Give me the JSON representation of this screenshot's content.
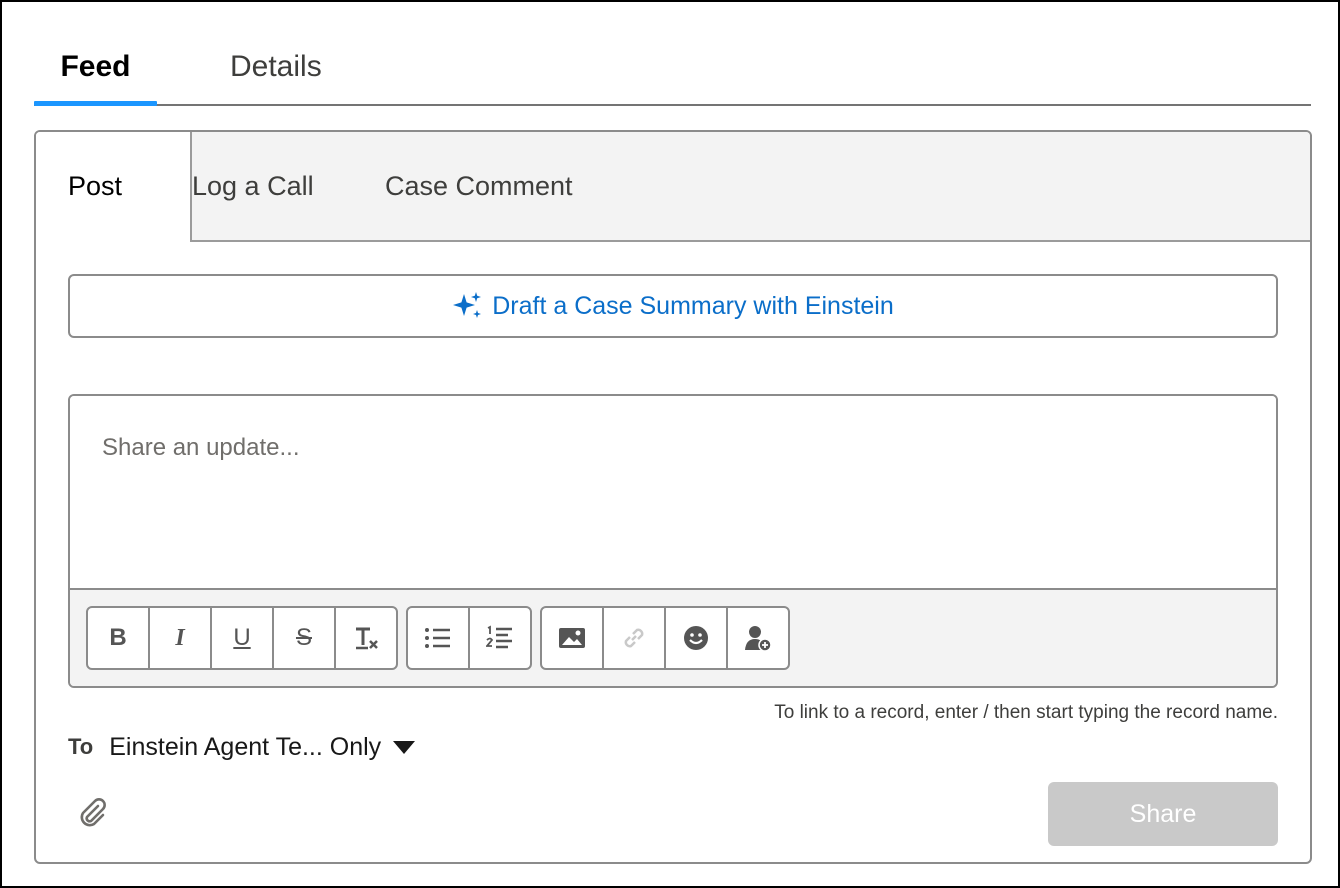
{
  "top_tabs": [
    {
      "label": "Feed",
      "active": true
    },
    {
      "label": "Details",
      "active": false
    }
  ],
  "publisher": {
    "tabs": [
      {
        "label": "Post",
        "active": true
      },
      {
        "label": "Log a Call",
        "active": false
      },
      {
        "label": "Case Comment",
        "active": false
      }
    ],
    "einstein_button": {
      "label": "Draft a Case Summary with Einstein",
      "icon": "sparkles-icon"
    },
    "editor": {
      "placeholder": "Share an update...",
      "value": ""
    },
    "toolbar": {
      "formatting": [
        "bold-icon",
        "italic-icon",
        "underline-icon",
        "strikethrough-icon",
        "clear-formatting-icon"
      ],
      "lists": [
        "bulleted-list-icon",
        "numbered-list-icon"
      ],
      "insert": [
        "image-icon",
        "link-icon",
        "emoji-icon",
        "mention-user-icon"
      ],
      "bold_glyph": "B",
      "italic_glyph": "I",
      "underline_glyph": "U",
      "strike_glyph": "S",
      "clear_glyph": "T"
    },
    "hint": "To link to a record, enter / then start typing the record name.",
    "to_label": "To",
    "to_value": "Einstein Agent Te... Only",
    "share_label": "Share",
    "colors": {
      "accent": "#1b96ff",
      "link": "#0b6ec9",
      "disabled": "#c9c9c9"
    }
  }
}
